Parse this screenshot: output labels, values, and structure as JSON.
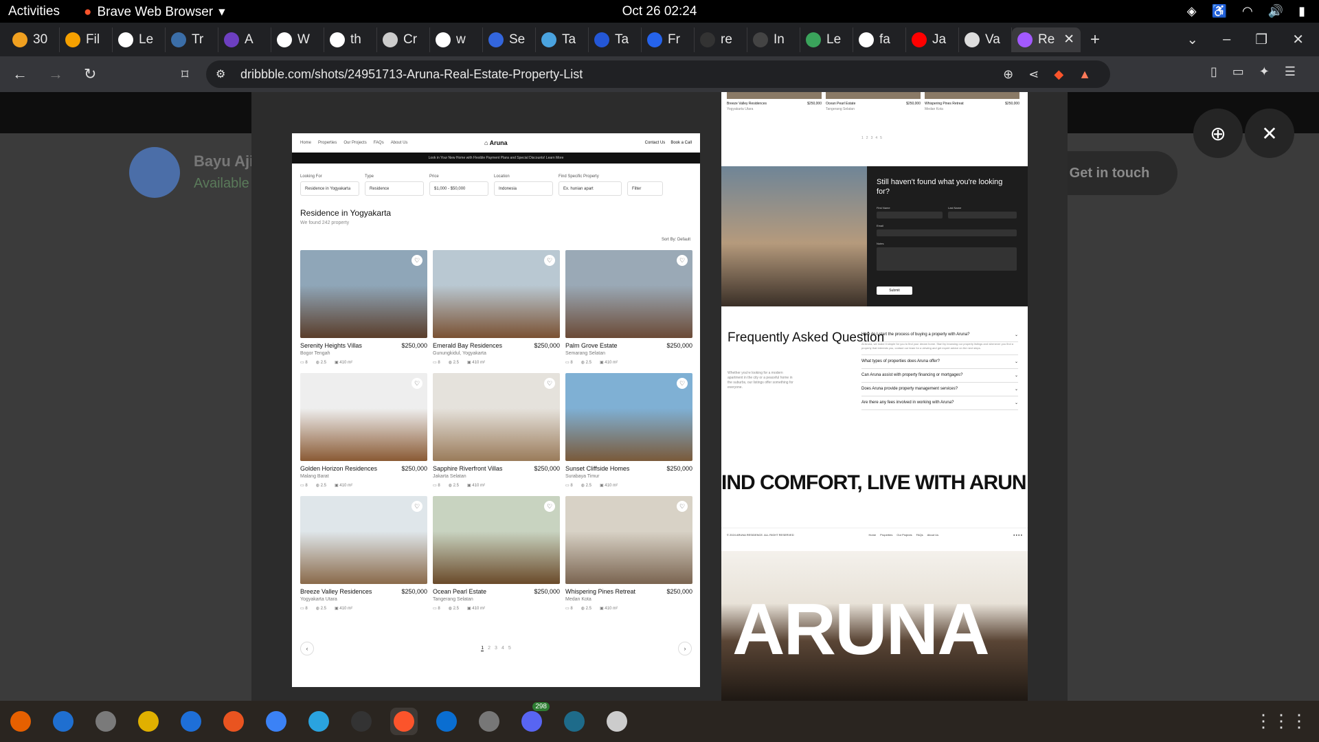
{
  "system": {
    "activities": "Activities",
    "app_name": "Brave Web Browser",
    "clock": "Oct 26  02:24"
  },
  "tabs": [
    {
      "title": "30",
      "color": "#f0a020"
    },
    {
      "title": "Fil",
      "color": "#f5a000"
    },
    {
      "title": "Le",
      "color": "#ffffff"
    },
    {
      "title": "Tr",
      "color": "#3b6ea8"
    },
    {
      "title": "A",
      "color": "#6d3fc0"
    },
    {
      "title": "W",
      "color": "#ffffff"
    },
    {
      "title": "th",
      "color": "#ffffff"
    },
    {
      "title": "Cr",
      "color": "#cccccc"
    },
    {
      "title": "w",
      "color": "#ffffff"
    },
    {
      "title": "Se",
      "color": "#3366dd"
    },
    {
      "title": "Ta",
      "color": "#4aa3df"
    },
    {
      "title": "Ta",
      "color": "#2457d6"
    },
    {
      "title": "Fr",
      "color": "#2563eb"
    },
    {
      "title": "re",
      "color": "#333333"
    },
    {
      "title": "In",
      "color": "#444444"
    },
    {
      "title": "Le",
      "color": "#3aa35b"
    },
    {
      "title": "fa",
      "color": "#ffffff"
    },
    {
      "title": "Ja",
      "color": "#ff0000"
    },
    {
      "title": "Va",
      "color": "#dddddd"
    },
    {
      "title": "Re",
      "color": "#a259ff"
    }
  ],
  "url": "dribbble.com/shots/24951713-Aruna-Real-Estate-Property-List",
  "background": {
    "author": "Bayu Aji",
    "available": "Available",
    "get_in_touch": "Get in touch"
  },
  "shot": {
    "nav_links": [
      "Home",
      "Properties",
      "Our Projects",
      "FAQs",
      "About Us"
    ],
    "brand": "Aruna",
    "nav_right": [
      "Contact Us",
      "Book a Call"
    ],
    "promo": "Look in Your New Home with Flexible Payment Plans and Special Discounts!  Learn More",
    "filters": [
      {
        "label": "Looking For",
        "value": "Residence in Yogyakarta"
      },
      {
        "label": "Type",
        "value": "Residence"
      },
      {
        "label": "Price",
        "value": "$1,000 - $50,000"
      },
      {
        "label": "Location",
        "value": "Indonesia"
      },
      {
        "label": "Find Specific Property",
        "value": "Ex. hunian apart"
      }
    ],
    "filter_button": "Filter",
    "section_title": "Residence in Yogyakarta",
    "found_text": "We found 242 property",
    "sort_by": "Sort By:  Default",
    "cards": [
      {
        "name": "Serenity Heights Villas",
        "price": "$250,000",
        "location": "Bogor Tengah",
        "beds": "8",
        "baths": "2.5",
        "area": "410 m²",
        "c1": "#8fa6b8",
        "c2": "#5a3d2a"
      },
      {
        "name": "Emerald Bay Residences",
        "price": "$250,000",
        "location": "Gunungkidul, Yogyakarta",
        "beds": "8",
        "baths": "2.5",
        "area": "410 m²",
        "c1": "#b9c8d2",
        "c2": "#7a5132"
      },
      {
        "name": "Palm Grove Estate",
        "price": "$250,000",
        "location": "Semarang Selatan",
        "beds": "8",
        "baths": "2.5",
        "area": "410 m²",
        "c1": "#9aa9b6",
        "c2": "#6b4a36"
      },
      {
        "name": "Golden Horizon Residences",
        "price": "$250,000",
        "location": "Malang Barat",
        "beds": "8",
        "baths": "2.5",
        "area": "410 m²",
        "c1": "#eeeeee",
        "c2": "#8a5a34"
      },
      {
        "name": "Sapphire Riverfront Villas",
        "price": "$250,000",
        "location": "Jakarta Selatan",
        "beds": "8",
        "baths": "2.5",
        "area": "410 m²",
        "c1": "#e5e2dc",
        "c2": "#9a7b5a"
      },
      {
        "name": "Sunset Cliffside Homes",
        "price": "$250,000",
        "location": "Surabaya Timur",
        "beds": "8",
        "baths": "2.5",
        "area": "410 m²",
        "c1": "#7fb0d4",
        "c2": "#7a5a3a"
      },
      {
        "name": "Breeze Valley Residences",
        "price": "$250,000",
        "location": "Yogyakarta Utara",
        "beds": "8",
        "baths": "2.5",
        "area": "410 m²",
        "c1": "#dfe6ea",
        "c2": "#8a6a4a"
      },
      {
        "name": "Ocean Pearl Estate",
        "price": "$250,000",
        "location": "Tangerang Selatan",
        "beds": "8",
        "baths": "2.5",
        "area": "410 m²",
        "c1": "#c8d3c0",
        "c2": "#6a4a2a"
      },
      {
        "name": "Whispering Pines Retreat",
        "price": "$250,000",
        "location": "Medan Kota",
        "beds": "8",
        "baths": "2.5",
        "area": "410 m²",
        "c1": "#d8d2c6",
        "c2": "#7a6450"
      }
    ],
    "pages": [
      "1",
      "2",
      "3",
      "4",
      "5"
    ]
  },
  "shot2": {
    "top_cards": [
      {
        "name": "Breeze Valley Residences",
        "price": "$250,000",
        "location": "Yogyakarta Utara"
      },
      {
        "name": "Ocean Pearl Estate",
        "price": "$250,000",
        "location": "Tangerang Selatan"
      },
      {
        "name": "Whispering Pines Retreat",
        "price": "$250,000",
        "location": "Medan Kota"
      }
    ],
    "contact_title": "Still haven't found what you're looking for?",
    "contact_fields": [
      "First Name",
      "Last Name",
      "Email",
      "Notes"
    ],
    "submit": "Submit",
    "faq_title": "Frequently Asked Question",
    "faq_desc": "Whether you're looking for a modern apartment in the city or a peaceful home in the suburbs, our listings offer something for everyone.",
    "faqs": [
      {
        "q": "How do I start the process of buying a property with Aruna?",
        "a": "At Aruna, we make it simple for you to find your dream home. Start by browsing our property listings and whenever you find a property that interests you, contact our team for a viewing and get expert advice on the next steps."
      },
      {
        "q": "What types of properties does Aruna offer?"
      },
      {
        "q": "Can Aruna assist with property financing or mortgages?"
      },
      {
        "q": "Does Aruna provide property management services?"
      },
      {
        "q": "Are there any fees involved in working with Aruna?"
      }
    ],
    "marquee": "IND COMFORT, LIVE WITH ARUN",
    "footer_copy": "© 2024 ARUNA RESIDENCE. ALL RIGHT RESERVED",
    "footer_links": [
      "Home",
      "Properties",
      "Our Projects",
      "FAQs",
      "About Us"
    ],
    "hero_word": "ARUNA"
  },
  "dock": [
    {
      "name": "firefox",
      "color": "#e66000"
    },
    {
      "name": "thunderbird",
      "color": "#1f6fd0"
    },
    {
      "name": "files",
      "color": "#7a7a7a"
    },
    {
      "name": "rhythmbox",
      "color": "#e0b000"
    },
    {
      "name": "writer",
      "color": "#1e6fd8"
    },
    {
      "name": "software",
      "color": "#e95420"
    },
    {
      "name": "help",
      "color": "#3b82f6"
    },
    {
      "name": "telegram",
      "color": "#2aa3df"
    },
    {
      "name": "terminal",
      "color": "#333333"
    },
    {
      "name": "brave",
      "color": "#fb542b"
    },
    {
      "name": "vscode",
      "color": "#0a6ed1"
    },
    {
      "name": "settings",
      "color": "#777777"
    },
    {
      "name": "discord",
      "color": "#5865f2",
      "badge": "298"
    },
    {
      "name": "sublime",
      "color": "#1e6b8a"
    },
    {
      "name": "search",
      "color": "#cccccc"
    }
  ]
}
